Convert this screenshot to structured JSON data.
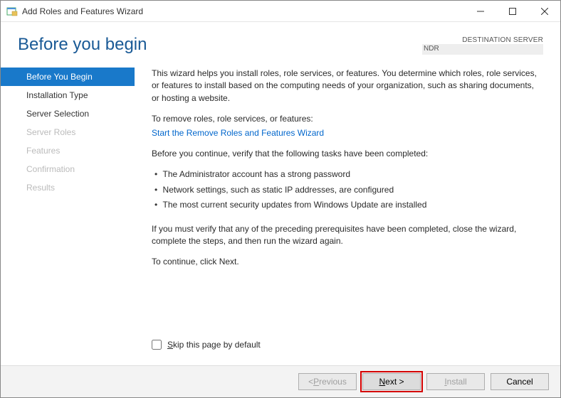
{
  "titlebar": {
    "title": "Add Roles and Features Wizard",
    "minimize_label": "Minimize",
    "maximize_label": "Maximize",
    "close_label": "Close"
  },
  "header": {
    "page_title": "Before you begin",
    "dest_label": "DESTINATION SERVER",
    "dest_server": "NDR"
  },
  "sidebar": {
    "items": [
      {
        "label": "Before You Begin",
        "state": "selected"
      },
      {
        "label": "Installation Type",
        "state": "enabled"
      },
      {
        "label": "Server Selection",
        "state": "enabled"
      },
      {
        "label": "Server Roles",
        "state": "disabled"
      },
      {
        "label": "Features",
        "state": "disabled"
      },
      {
        "label": "Confirmation",
        "state": "disabled"
      },
      {
        "label": "Results",
        "state": "disabled"
      }
    ]
  },
  "content": {
    "intro": "This wizard helps you install roles, role services, or features. You determine which roles, role services, or features to install based on the computing needs of your organization, such as sharing documents, or hosting a website.",
    "remove_intro": "To remove roles, role services, or features:",
    "remove_link": "Start the Remove Roles and Features Wizard",
    "verify_intro": "Before you continue, verify that the following tasks have been completed:",
    "bullets": [
      "The Administrator account has a strong password",
      "Network settings, such as static IP addresses, are configured",
      "The most current security updates from Windows Update are installed"
    ],
    "verify_note": "If you must verify that any of the preceding prerequisites have been completed, close the wizard, complete the steps, and then run the wizard again.",
    "continue_note": "To continue, click Next.",
    "skip_label": "Skip this page by default",
    "skip_checked": false
  },
  "footer": {
    "previous": "< Previous",
    "next": "Next >",
    "install": "Install",
    "cancel": "Cancel"
  }
}
